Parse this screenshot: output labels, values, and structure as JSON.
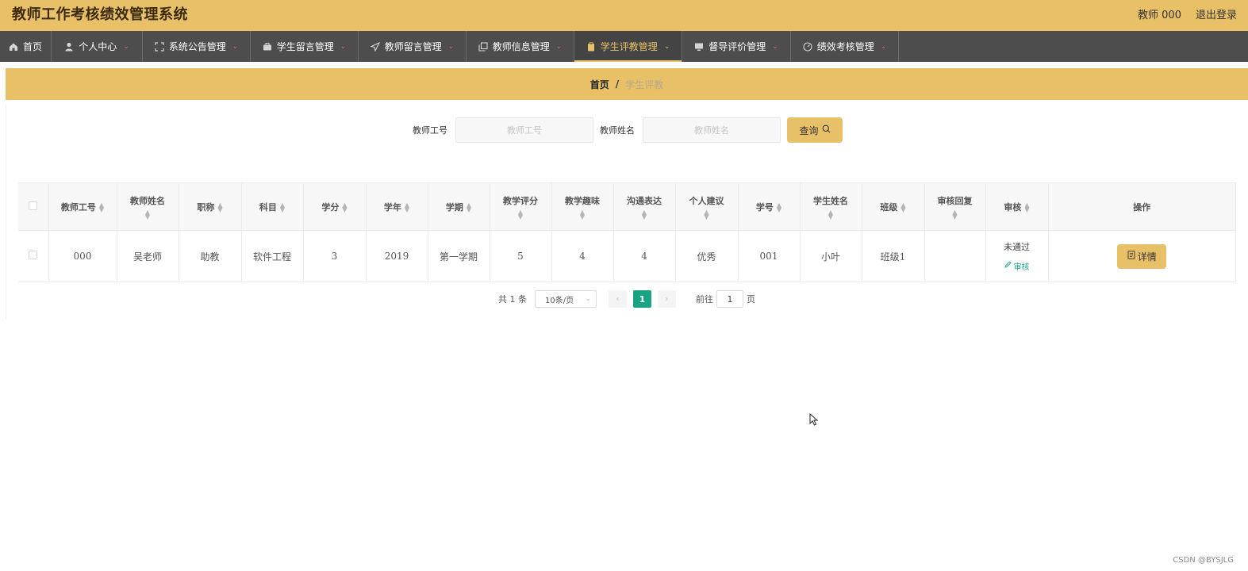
{
  "app": {
    "title": "教师工作考核绩效管理系统",
    "user": "教师 000",
    "logout": "退出登录"
  },
  "nav": [
    {
      "label": "首页",
      "icon": "home-icon"
    },
    {
      "label": "个人中心",
      "icon": "user-icon"
    },
    {
      "label": "系统公告管理",
      "icon": "expand-icon"
    },
    {
      "label": "学生留言管理",
      "icon": "briefcase-icon"
    },
    {
      "label": "教师留言管理",
      "icon": "send-icon"
    },
    {
      "label": "教师信息管理",
      "icon": "copy-icon"
    },
    {
      "label": "学生评教管理",
      "icon": "clipboard-icon",
      "active": true
    },
    {
      "label": "督导评价管理",
      "icon": "monitor-icon"
    },
    {
      "label": "绩效考核管理",
      "icon": "gauge-icon"
    }
  ],
  "breadcrumb": {
    "home": "首页",
    "separator": "/",
    "current": "学生评教"
  },
  "search": {
    "teacher_id_label": "教师工号",
    "teacher_id_placeholder": "教师工号",
    "teacher_name_label": "教师姓名",
    "teacher_name_placeholder": "教师姓名",
    "button": "查询"
  },
  "table": {
    "headers": [
      "教师工号",
      "教师姓名",
      "职称",
      "科目",
      "学分",
      "学年",
      "学期",
      "教学评分",
      "教学趣味",
      "沟通表达",
      "个人建议",
      "学号",
      "学生姓名",
      "班级",
      "审核回复",
      "审核",
      "操作"
    ],
    "rows": [
      {
        "teacher_id": "000",
        "teacher_name": "吴老师",
        "title": "助教",
        "subject": "软件工程",
        "credit": "3",
        "year": "2019",
        "semester": "第一学期",
        "score": "5",
        "interest": "4",
        "expression": "4",
        "suggestion": "优秀",
        "student_id": "001",
        "student_name": "小叶",
        "class": "班级1",
        "reply": "",
        "audit_status": "未通过",
        "audit_link": "审核",
        "detail": "详情"
      }
    ]
  },
  "pager": {
    "total": "共 1 条",
    "page_size": "10条/页",
    "current": "1",
    "goto": "前往",
    "goto_value": "1",
    "page_unit": "页"
  },
  "watermark": "CSDN @BYSJLG",
  "colors": {
    "accent": "#e8c068",
    "nav_bg": "#4d4d4d",
    "page_active": "#18a385"
  }
}
